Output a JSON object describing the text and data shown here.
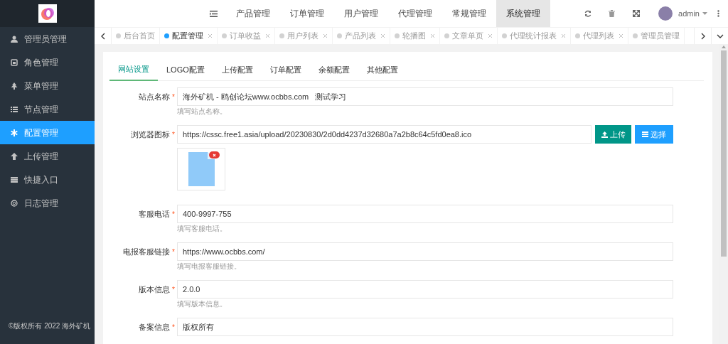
{
  "sidebar": {
    "items": [
      {
        "label": "管理员管理",
        "selected": false
      },
      {
        "label": "角色管理",
        "selected": false
      },
      {
        "label": "菜单管理",
        "selected": false
      },
      {
        "label": "节点管理",
        "selected": false
      },
      {
        "label": "配置管理",
        "selected": true
      },
      {
        "label": "上传管理",
        "selected": false
      },
      {
        "label": "快捷入口",
        "selected": false
      },
      {
        "label": "日志管理",
        "selected": false
      }
    ],
    "footer": "©版权所有 2022 海外矿机"
  },
  "top_nav": {
    "items": [
      {
        "label": "产品管理",
        "selected": false
      },
      {
        "label": "订单管理",
        "selected": false
      },
      {
        "label": "用户管理",
        "selected": false
      },
      {
        "label": "代理管理",
        "selected": false
      },
      {
        "label": "常规管理",
        "selected": false
      },
      {
        "label": "系统管理",
        "selected": true
      }
    ],
    "user": "admin"
  },
  "tab_bar": {
    "tabs": [
      {
        "label": "后台首页",
        "selected": false,
        "closable": false
      },
      {
        "label": "配置管理",
        "selected": true,
        "closable": true
      },
      {
        "label": "订单收益",
        "selected": false,
        "closable": true
      },
      {
        "label": "用户列表",
        "selected": false,
        "closable": true
      },
      {
        "label": "产品列表",
        "selected": false,
        "closable": true
      },
      {
        "label": "轮播图",
        "selected": false,
        "closable": true
      },
      {
        "label": "文章单页",
        "selected": false,
        "closable": true
      },
      {
        "label": "代理统计报表",
        "selected": false,
        "closable": true
      },
      {
        "label": "代理列表",
        "selected": false,
        "closable": true
      },
      {
        "label": "管理员管理",
        "selected": false,
        "closable": false
      }
    ]
  },
  "settings_tabs": [
    {
      "label": "网站设置",
      "selected": true
    },
    {
      "label": "LOGO配置",
      "selected": false
    },
    {
      "label": "上传配置",
      "selected": false
    },
    {
      "label": "订单配置",
      "selected": false
    },
    {
      "label": "余额配置",
      "selected": false
    },
    {
      "label": "其他配置",
      "selected": false
    }
  ],
  "form": {
    "fields": [
      {
        "kind": "text",
        "label": "站点名称",
        "required_mark": "*",
        "value": "海外矿机 - 鸥创论坛www.ocbbs.com   测试学习",
        "hint": "填写站点名称。"
      },
      {
        "kind": "upload",
        "label": "浏览器图标",
        "required_mark": "*",
        "value": "https://cssc.free1.asia/upload/20230830/2d0dd4237d32680a7a2b8c64c5fd0ea8.ico",
        "upload_button": "上传",
        "choose_button": "选择"
      },
      {
        "kind": "text",
        "label": "客服电话",
        "required_mark": "*",
        "value": "400-9997-755",
        "hint": "填写客服电话。"
      },
      {
        "kind": "text",
        "label": "电报客服链接",
        "required_mark": "*",
        "value": "https://www.ocbbs.com/",
        "hint": "填写电报客服链接。"
      },
      {
        "kind": "text",
        "label": "版本信息",
        "required_mark": "*",
        "value": "2.0.0",
        "hint": "填写版本信息。"
      },
      {
        "kind": "text",
        "label": "备案信息",
        "required_mark": "*",
        "value": "版权所有"
      }
    ]
  }
}
